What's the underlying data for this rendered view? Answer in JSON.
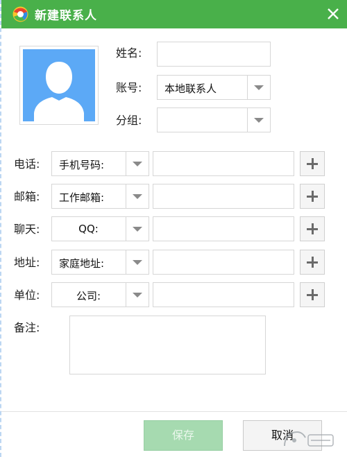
{
  "window": {
    "title": "新建联系人"
  },
  "form": {
    "name_label": "姓名:",
    "account_label": "账号:",
    "account_value": "本地联系人",
    "group_label": "分组:",
    "group_value": "",
    "phone_label": "电话:",
    "phone_type": "手机号码:",
    "email_label": "邮箱:",
    "email_type": "工作邮箱:",
    "chat_label": "聊天:",
    "chat_type": "QQ:",
    "address_label": "地址:",
    "address_type": "家庭地址:",
    "company_label": "单位:",
    "company_type": "公司:",
    "note_label": "备注:"
  },
  "buttons": {
    "save": "保存",
    "cancel": "取消"
  },
  "colors": {
    "titlebar": "#49b04a",
    "avatar_bg": "#5ca9f6",
    "save_disabled": "#a6dab0"
  }
}
